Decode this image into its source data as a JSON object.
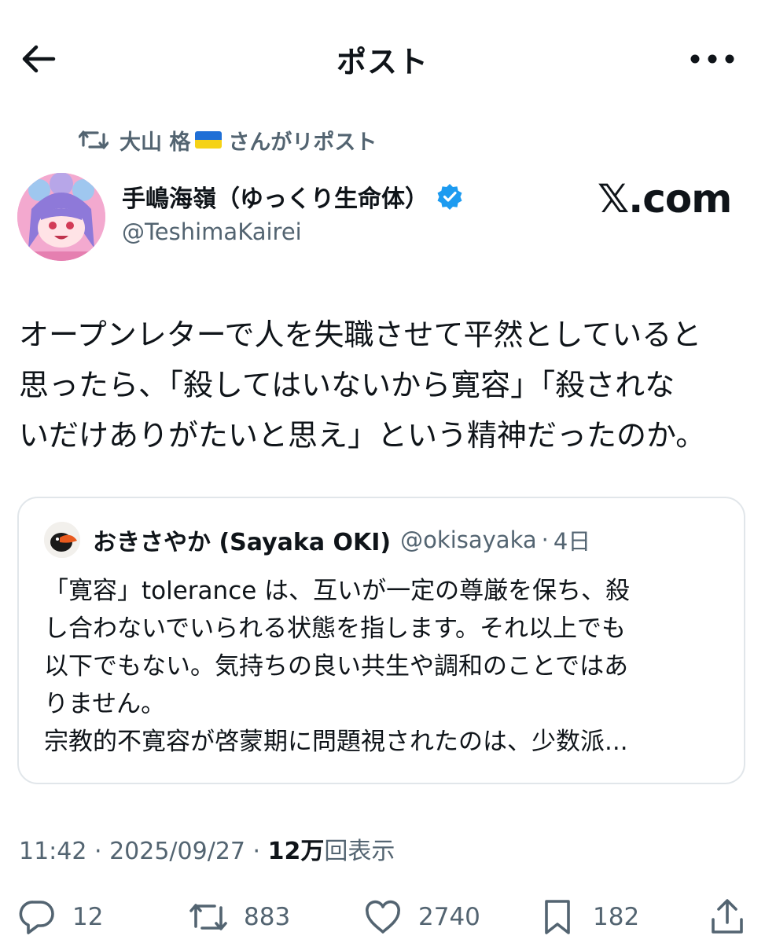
{
  "header": {
    "title": "ポスト"
  },
  "repost": {
    "name": "大山 格",
    "suffix": "さんがリポスト"
  },
  "author": {
    "display_name": "手嶋海嶺（ゆっくり生命体）",
    "handle": "@TeshimaKairei"
  },
  "watermark": "𝕏.com",
  "body_lines": [
    "オープンレターで人を失職させて平然としていると",
    "思ったら、「殺してはいないから寛容」「殺されな",
    "いだけありがたいと思え」という精神だったのか。"
  ],
  "quote": {
    "name": "おきさやか (Sayaka OKI)",
    "handle": "@okisayaka",
    "sep": "·",
    "time": "4日",
    "lines": [
      "「寛容」tolerance は、互いが一定の尊厳を保ち、殺",
      "し合わないでいられる状態を指します。それ以上でも",
      "以下でもない。気持ちの良い共生や調和のことではあ",
      "りません。",
      "宗教的不寛容が啓蒙期に問題視されたのは、少数派..."
    ]
  },
  "meta": {
    "time": "11:42",
    "sep1": " · ",
    "date": "2025/09/27",
    "sep2": " · ",
    "views_num": "12万",
    "views_label": "回表示"
  },
  "actions": {
    "replies": "12",
    "reposts": "883",
    "likes": "2740",
    "bookmarks": "182"
  },
  "colors": {
    "text": "#0f1419",
    "secondary": "#536471",
    "verified": "#1d9bf0",
    "border": "#e1e6ea"
  },
  "icons": [
    "back-arrow-icon",
    "more-icon",
    "repost-icon",
    "verified-icon",
    "reply-icon",
    "like-icon",
    "bookmark-icon",
    "share-icon"
  ]
}
